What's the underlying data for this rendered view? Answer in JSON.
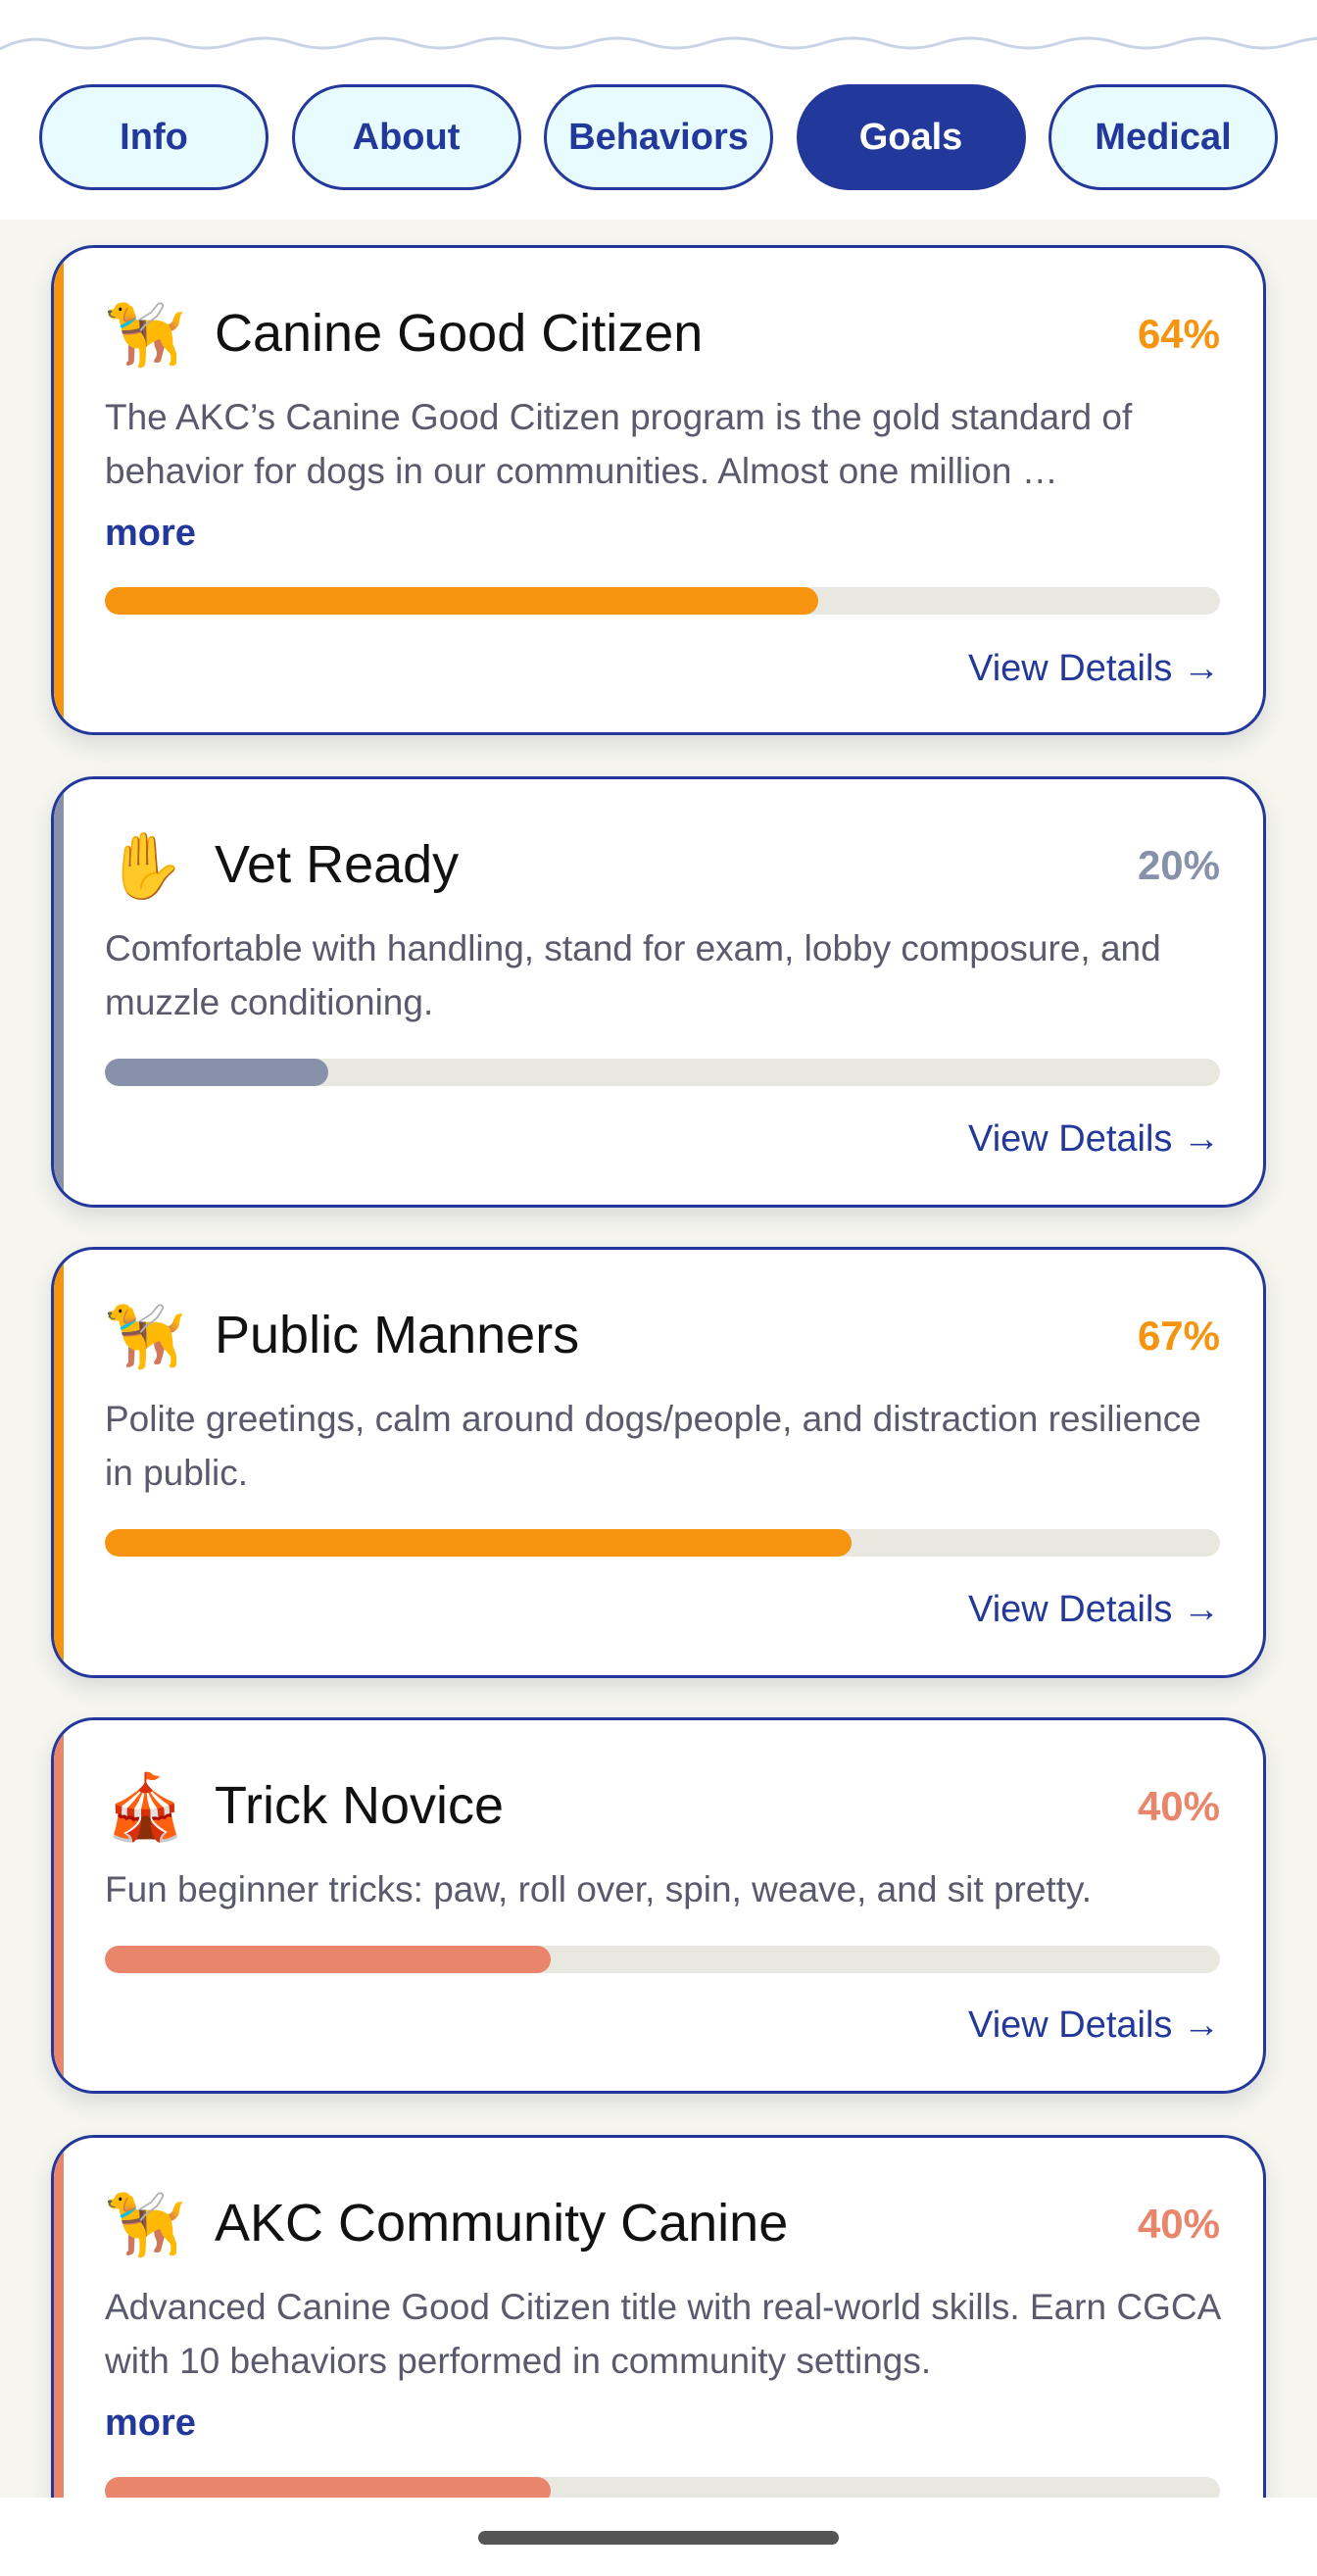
{
  "tabs": [
    {
      "label": "Info",
      "active": false
    },
    {
      "label": "About",
      "active": false
    },
    {
      "label": "Behaviors",
      "active": false
    },
    {
      "label": "Goals",
      "active": true
    },
    {
      "label": "Medical",
      "active": false
    }
  ],
  "goals": [
    {
      "icon": "service-dog-icon",
      "icon_glyph": "🦮",
      "title": "Canine Good Citizen",
      "percent_label": "64%",
      "progress": 0.64,
      "color": "#f7940f",
      "description": "The AKC’s Canine Good Citizen program is the gold standard of behavior for dogs in our communities. Almost one million …",
      "more_label": "more",
      "details_label": "View Details →"
    },
    {
      "icon": "raised-hand-icon",
      "icon_glyph": "✋",
      "title": "Vet Ready",
      "percent_label": "20%",
      "progress": 0.2,
      "color": "#8891aa",
      "description": "Comfortable with handling, stand for exam, lobby composure, and muzzle conditioning.",
      "more_label": "",
      "details_label": "View Details →"
    },
    {
      "icon": "service-dog-icon",
      "icon_glyph": "🦮",
      "title": "Public Manners",
      "percent_label": "67%",
      "progress": 0.67,
      "color": "#f7940f",
      "description": "Polite greetings, calm around dogs/people, and distraction resilience in public.",
      "more_label": "",
      "details_label": "View Details →"
    },
    {
      "icon": "circus-tent-icon",
      "icon_glyph": "🎪",
      "title": "Trick Novice",
      "percent_label": "40%",
      "progress": 0.4,
      "color": "#e8856b",
      "description": "Fun beginner tricks: paw, roll over, spin, weave, and sit pretty.",
      "more_label": "",
      "details_label": "View Details →"
    },
    {
      "icon": "service-dog-icon",
      "icon_glyph": "🦮",
      "title": "AKC Community Canine",
      "percent_label": "40%",
      "progress": 0.4,
      "color": "#e8856b",
      "description": "Advanced Canine Good Citizen title with real-world skills. Earn CGCA with 10 behaviors performed in community settings.",
      "more_label": "more",
      "details_label": ""
    }
  ]
}
